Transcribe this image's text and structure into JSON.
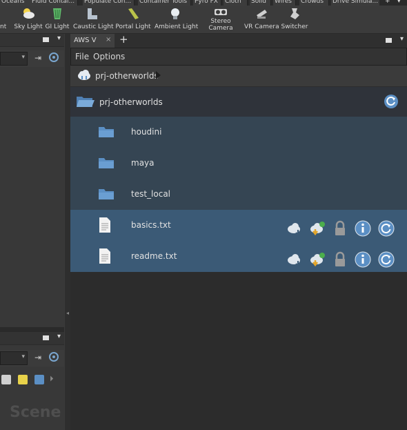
{
  "shelf_tabs": [
    "Oceans",
    "Fluid Contai...",
    "Populate Con...",
    "Container Tools",
    "Pyro FX",
    "Cloth",
    "Solid",
    "Wires",
    "Crowds",
    "Drive Simula..."
  ],
  "shelf_tools": {
    "cut_label": "nt",
    "items": [
      "Sky Light",
      "GI Light",
      "Caustic Light",
      "Portal Light",
      "Ambient Light",
      "Stereo",
      "Camera",
      "VR Camera",
      "Switcher"
    ]
  },
  "left_pane": {
    "scene_label": "Scene"
  },
  "browser": {
    "tab_label": "AWS V",
    "tab_close": "×",
    "add_tab": "+",
    "menu": [
      "File",
      "Options"
    ],
    "breadcrumb": "prj-otherworlds",
    "current_folder": "prj-otherworlds",
    "directories": [
      "houdini",
      "maya",
      "test_local"
    ],
    "files": [
      "basics.txt",
      "readme.txt"
    ]
  },
  "colors": {
    "accent_blue": "#5b8fc4",
    "dir_row_bg": "#354553",
    "file_row_bg": "#3b5a76"
  }
}
